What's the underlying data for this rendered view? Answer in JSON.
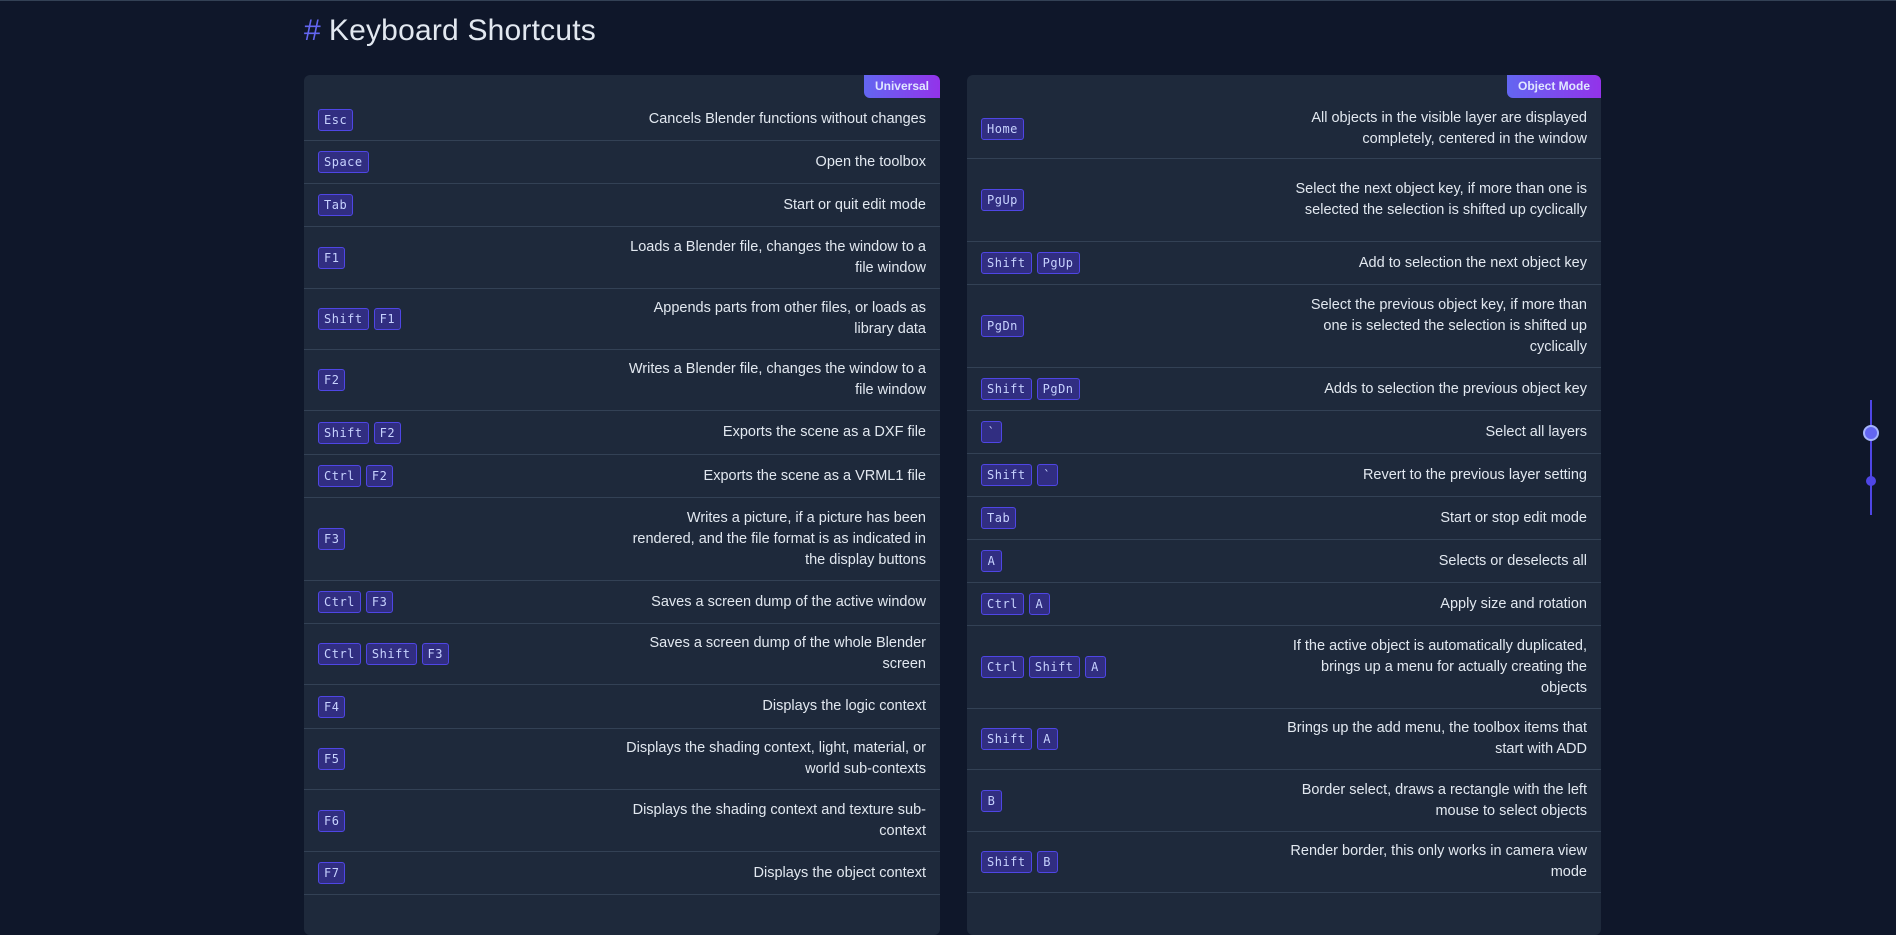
{
  "page": {
    "hash": "#",
    "title": "Keyboard Shortcuts"
  },
  "colors": {
    "background": "#0f172a",
    "panel": "#1e293b",
    "accent": "#6366f1",
    "kbd_bg": "#312e81"
  },
  "universal": {
    "badge": "Universal",
    "rows": [
      {
        "keys": [
          "Esc"
        ],
        "desc": "Cancels Blender functions without changes"
      },
      {
        "keys": [
          "Space"
        ],
        "desc": "Open the toolbox"
      },
      {
        "keys": [
          "Tab"
        ],
        "desc": "Start or quit edit mode"
      },
      {
        "keys": [
          "F1"
        ],
        "desc": "Loads a Blender file, changes the window to a file window"
      },
      {
        "keys": [
          "Shift",
          "F1"
        ],
        "desc": "Appends parts from other files, or loads as library data"
      },
      {
        "keys": [
          "F2"
        ],
        "desc": "Writes a Blender file, changes the window to a file window"
      },
      {
        "keys": [
          "Shift",
          "F2"
        ],
        "desc": "Exports the scene as a DXF file"
      },
      {
        "keys": [
          "Ctrl",
          "F2"
        ],
        "desc": "Exports the scene as a VRML1 file"
      },
      {
        "keys": [
          "F3"
        ],
        "desc": "Writes a picture, if a picture has been rendered, and the file format is as indicated in the display buttons"
      },
      {
        "keys": [
          "Ctrl",
          "F3"
        ],
        "desc": "Saves a screen dump of the active window"
      },
      {
        "keys": [
          "Ctrl",
          "Shift",
          "F3"
        ],
        "desc": "Saves a screen dump of the whole Blender screen"
      },
      {
        "keys": [
          "F4"
        ],
        "desc": "Displays the logic context"
      },
      {
        "keys": [
          "F5"
        ],
        "desc": "Displays the shading context, light, material, or world sub-contexts"
      },
      {
        "keys": [
          "F6"
        ],
        "desc": "Displays the shading context and texture sub-context"
      },
      {
        "keys": [
          "F7"
        ],
        "desc": "Displays the object context"
      }
    ]
  },
  "object_mode": {
    "badge": "Object Mode",
    "rows": [
      {
        "keys": [
          "Home"
        ],
        "desc": "All objects in the visible layer are displayed completely, centered in the window"
      },
      {
        "keys": [
          "PgUp"
        ],
        "desc": "Select the next object key, if more than one is selected the selection is shifted up cyclically"
      },
      {
        "keys": [
          "Shift",
          "PgUp"
        ],
        "desc": "Add to selection the next object key"
      },
      {
        "keys": [
          "PgDn"
        ],
        "desc": "Select the previous object key, if more than one is selected the selection is shifted up cyclically"
      },
      {
        "keys": [
          "Shift",
          "PgDn"
        ],
        "desc": "Adds to selection the previous object key"
      },
      {
        "keys": [
          "`"
        ],
        "desc": "Select all layers"
      },
      {
        "keys": [
          "Shift",
          "`"
        ],
        "desc": "Revert to the previous layer setting"
      },
      {
        "keys": [
          "Tab"
        ],
        "desc": "Start or stop edit mode"
      },
      {
        "keys": [
          "A"
        ],
        "desc": "Selects or deselects all"
      },
      {
        "keys": [
          "Ctrl",
          "A"
        ],
        "desc": "Apply size and rotation"
      },
      {
        "keys": [
          "Ctrl",
          "Shift",
          "A"
        ],
        "desc": "If the active object is automatically duplicated, brings up a menu for actually creating the objects"
      },
      {
        "keys": [
          "Shift",
          "A"
        ],
        "desc": "Brings up the add menu, the toolbox items that start with ADD"
      },
      {
        "keys": [
          "B"
        ],
        "desc": "Border select, draws a rectangle with the left mouse to select objects"
      },
      {
        "keys": [
          "Shift",
          "B"
        ],
        "desc": "Render border, this only works in camera view mode"
      }
    ]
  }
}
